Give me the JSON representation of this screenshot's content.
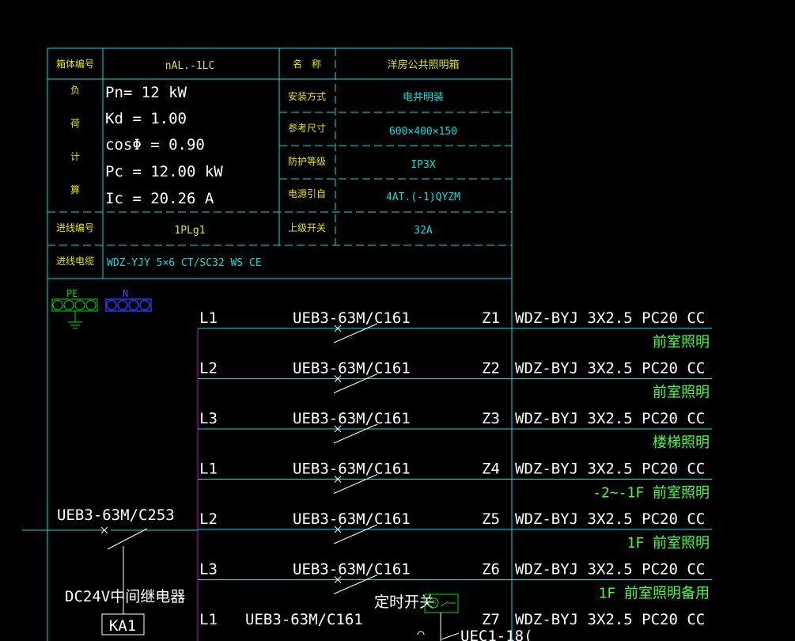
{
  "box_table": {
    "box_no_label": "箱体编号",
    "box_no": "nAL.-1LC",
    "name_label": "名　称",
    "name": "洋房公共照明箱",
    "load_calc_chars": [
      "负",
      "荷",
      "计",
      "算"
    ],
    "pn": "Pn= 12 kW",
    "kd": "Kd = 1.00",
    "cos": "cosΦ = 0.90",
    "pc": "Pc = 12.00 kW",
    "ic": "Ic = 20.26  A",
    "install_label": "安装方式",
    "install": "电井明装",
    "size_label": "参考尺寸",
    "size": "600×400×150",
    "protect_label": "防护等级",
    "protect": "IP3X",
    "source_label": "电源引自",
    "source": "4AT.(-1)QYZM",
    "incoming_no_label": "进线编号",
    "incoming_no": "1PLg1",
    "upper_switch_label": "上级开关",
    "upper_switch": "32A",
    "incoming_cable_label": "进线电缆",
    "incoming_cable": "WDZ-YJY 5×6 CT/SC32 WS CE"
  },
  "bus": {
    "pe": "PE",
    "n": "N"
  },
  "main_breaker": "UEB3-63M/C253",
  "relay": {
    "label": "DC24V中间继电器",
    "tag": "KA1"
  },
  "timer": {
    "label": "定时开关",
    "partial": "UEC1-18("
  },
  "circuits": [
    {
      "phase": "L1",
      "breaker": "UEB3-63M/C161",
      "id": "Z1",
      "cable": "WDZ-BYJ 3X2.5 PC20 CC",
      "desc": "前室照明"
    },
    {
      "phase": "L2",
      "breaker": "UEB3-63M/C161",
      "id": "Z2",
      "cable": "WDZ-BYJ 3X2.5 PC20 CC",
      "desc": "前室照明"
    },
    {
      "phase": "L3",
      "breaker": "UEB3-63M/C161",
      "id": "Z3",
      "cable": "WDZ-BYJ 3X2.5 PC20 CC",
      "desc": "楼梯照明"
    },
    {
      "phase": "L1",
      "breaker": "UEB3-63M/C161",
      "id": "Z4",
      "cable": "WDZ-BYJ 3X2.5 PC20 CC",
      "desc": "-2~-1F 前室照明"
    },
    {
      "phase": "L2",
      "breaker": "UEB3-63M/C161",
      "id": "Z5",
      "cable": "WDZ-BYJ 3X2.5 PC20 CC",
      "desc": "1F 前室照明"
    },
    {
      "phase": "L3",
      "breaker": "UEB3-63M/C161",
      "id": "Z6",
      "cable": "WDZ-BYJ 3X2.5 PC20 CC",
      "desc": "1F 前室照明备用"
    },
    {
      "phase": "L1",
      "breaker": "UEB3-63M/C161",
      "id": "Z7",
      "cable": "WDZ-BYJ 3X2.5 PC20 CC",
      "desc": ""
    }
  ]
}
